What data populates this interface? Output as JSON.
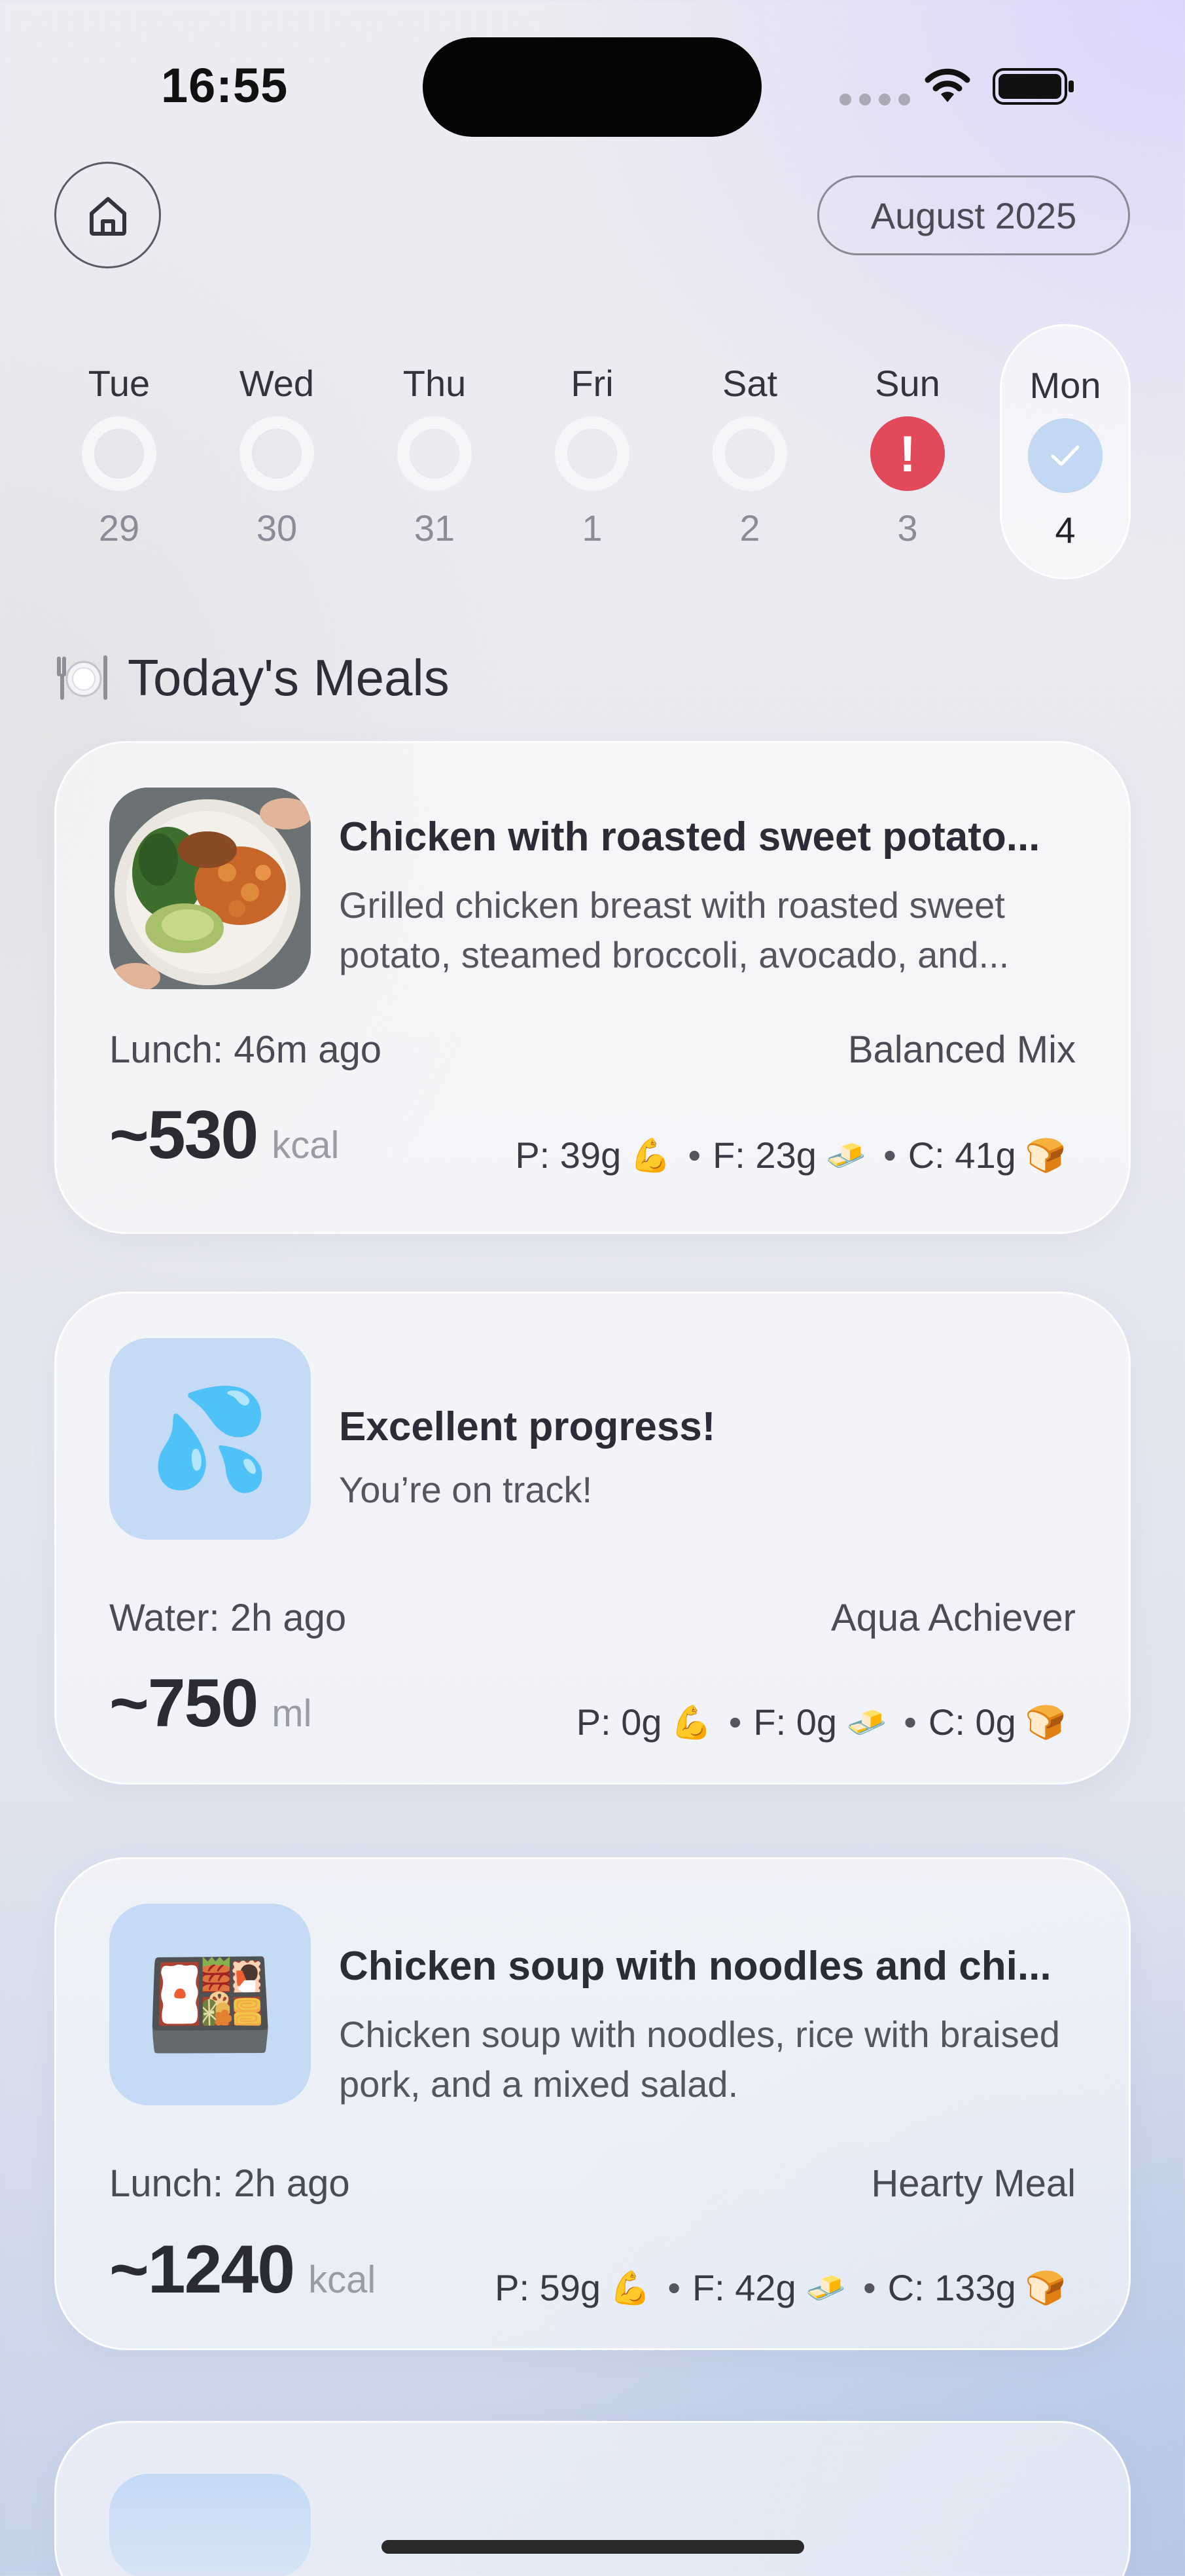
{
  "status_bar": {
    "time": "16:55"
  },
  "header": {
    "month": "August 2025"
  },
  "week": [
    {
      "day": "Tue",
      "date": "29",
      "state": "empty"
    },
    {
      "day": "Wed",
      "date": "30",
      "state": "empty"
    },
    {
      "day": "Thu",
      "date": "31",
      "state": "empty"
    },
    {
      "day": "Fri",
      "date": "1",
      "state": "empty"
    },
    {
      "day": "Sat",
      "date": "2",
      "state": "empty"
    },
    {
      "day": "Sun",
      "date": "3",
      "state": "alert",
      "mark": "!"
    },
    {
      "day": "Mon",
      "date": "4",
      "state": "done",
      "selected": true
    }
  ],
  "section": {
    "icon": "plate-icon",
    "title": "Today's Meals"
  },
  "meals": [
    {
      "title": "Chicken with roasted sweet potato...",
      "description": "Grilled chicken breast with roasted sweet potato, steamed broccoli, avocado, and...",
      "meta": "Lunch: 46m ago",
      "tag": "Balanced Mix",
      "amount": "~530",
      "unit": "kcal",
      "protein": "P: 39g",
      "fat": "F: 23g",
      "carbs": "C: 41g",
      "thumb": "food-photo"
    },
    {
      "title": "Excellent progress!",
      "description": "You’re on track!",
      "meta": "Water: 2h ago",
      "tag": "Aqua Achiever",
      "amount": "~750",
      "unit": "ml",
      "protein": "P: 0g",
      "fat": "F: 0g",
      "carbs": "C: 0g",
      "thumb": "💦"
    },
    {
      "title": "Chicken soup with noodles and chi...",
      "description": "Chicken soup with noodles, rice with braised pork, and a mixed salad.",
      "meta": "Lunch: 2h ago",
      "tag": "Hearty Meal",
      "amount": "~1240",
      "unit": "kcal",
      "protein": "P: 59g",
      "fat": "F: 42g",
      "carbs": "C: 133g",
      "thumb": "🍱"
    }
  ],
  "macro_icons": {
    "protein": "💪",
    "fat": "🧈",
    "carbs": "🍞"
  },
  "colors": {
    "alert": "#e24a5b",
    "done": "#c2d8f3",
    "thumb_bg": "#c4daf5"
  }
}
